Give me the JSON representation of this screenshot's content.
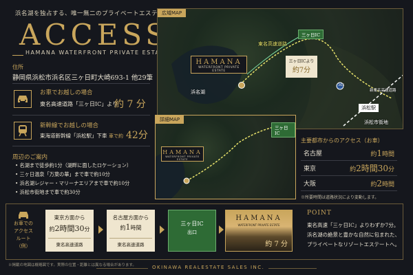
{
  "header": {
    "subtitle": "浜名湖を独占する、唯一無二のプライベートエステート",
    "title": "ACCESS",
    "title_sub": "HAMANA WATERFRONT PRIVATE ESTATE"
  },
  "address": {
    "label": "住所",
    "value": "静岡県浜松市浜名区三ヶ日町大崎693-1 他29筆"
  },
  "methods": [
    {
      "icon": "car-icon",
      "title": "お車でお越しの場合",
      "desc": "東名高速道路「三ヶ日IC」より",
      "time": "約 7 分"
    },
    {
      "icon": "train-icon",
      "title": "新幹線でお越しの場合",
      "desc": "東海道新幹線「浜松駅」下車",
      "time_prefix": "車で約",
      "time": "42分"
    }
  ],
  "surroundings": {
    "title": "周辺のご案内",
    "items": [
      "名湖まで徒歩約1分（湖畔に面したロケーション）",
      "三ヶ日温泉「万葉の華」まで車で約10分",
      "浜名湖レジャー・マリーナエリアまで車で約10分",
      "浜松市街地まで車で約30分"
    ]
  },
  "wide_map": {
    "tag": "広域MAP",
    "logo_main": "HAMANA",
    "logo_sub": "WATERFRONT PRIVATE ESTATE",
    "lake": "浜名湖",
    "highway": "東名高速道路",
    "ic": "三ヶ日IC",
    "callout_top": "三ヶ日ICより",
    "callout_time": "約7分",
    "route_no": "362",
    "ring_road": "新東名高速道路",
    "station": "浜松駅",
    "city": "浜松市街地"
  },
  "detail_map": {
    "tag": "詳細MAP",
    "ic": "三ヶ日IC",
    "logo_main": "HAMANA",
    "logo_sub": "WATERFRONT PRIVATE ESTATE"
  },
  "cities": {
    "title": "主要都市からのアクセス（お車）",
    "rows": [
      {
        "name": "名古屋",
        "time_prefix": "約",
        "time": "1",
        "unit": "時間"
      },
      {
        "name": "東京",
        "time_prefix": "約",
        "time": "2時間30",
        "unit": "分"
      },
      {
        "name": "大阪",
        "time_prefix": "約",
        "time": "2",
        "unit": "時間"
      }
    ],
    "note": "※所要時間は道路状況により変動します。"
  },
  "route": {
    "label_lines": [
      "お車での",
      "アクセス",
      "ルート（例）"
    ],
    "cards": [
      {
        "top": "東京方面から",
        "mid_prefix": "約",
        "mid": "2時間30",
        "mid_suffix": "分",
        "bot": "東名高速道路"
      },
      {
        "top": "名古屋方面から",
        "mid_prefix": "約",
        "mid": "1",
        "mid_suffix": "時間",
        "bot": "東名高速道路"
      },
      {
        "top": "三ヶ日IC",
        "mid": "出口",
        "bot": "",
        "green": true
      }
    ],
    "dest": {
      "logo_main": "HAMANA",
      "logo_sub": "WATERFRONT PRIVATE ESTATE",
      "time": "約 7 分"
    }
  },
  "point": {
    "title": "POINT",
    "lines": [
      "東名高速「三ヶ日IC」よりわずか7分。",
      "浜名湖の絶景と豊かな自然に包まれた、",
      "プライベートなリゾートエステートへ。"
    ]
  },
  "footer": {
    "note": "※掲載の地図は概略図です。実際の位置・距離とは異なる場合があります。",
    "brand": "OKINAWA REALESTATE SALES INC."
  }
}
